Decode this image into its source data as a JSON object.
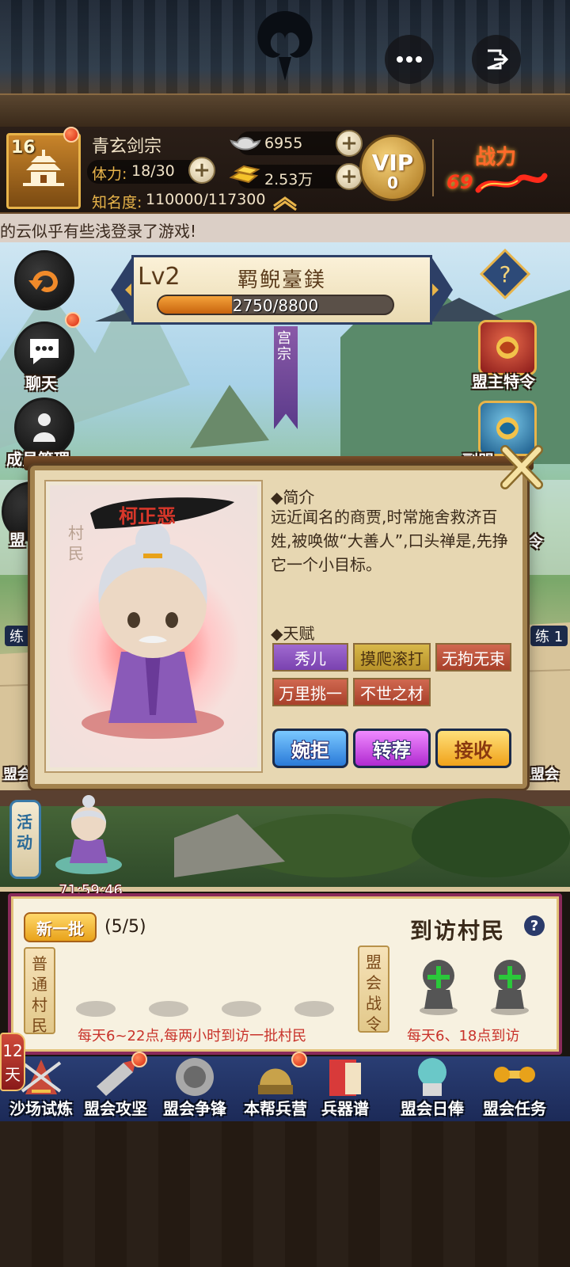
{
  "header": {
    "more_icon": "more-dots-icon",
    "exit_icon": "exit-icon"
  },
  "player": {
    "level": "16",
    "sect_name": "青玄剑宗",
    "stamina_label": "体力:",
    "stamina_value": "18/30",
    "fame_label": "知名度:",
    "fame_value": "110000/117300",
    "silver": "6955",
    "gold": "2.53万",
    "vip_label": "VIP",
    "vip_level": "0",
    "power_label": "战力",
    "power_value": "69"
  },
  "marquee": {
    "text": "的云似乎有些浅登录了游戏!"
  },
  "guild": {
    "level": "Lv2",
    "name": "羁鲵臺鎂",
    "exp_text": "2750/8800",
    "exp_current": 2750,
    "exp_max": 8800,
    "sect_ribbon": "宫宗"
  },
  "left_buttons": {
    "chat": "聊天",
    "members": "成员管理",
    "league": "盟",
    "train": "练",
    "train_num": "1",
    "meeting": "盟会"
  },
  "right_buttons": {
    "leader_order": "盟主特令",
    "second": "副盟",
    "order_short": "令",
    "train": "练",
    "train_num": "1",
    "meeting": "盟会"
  },
  "dialog": {
    "npc_name": "柯正恶",
    "npc_type": "村民",
    "intro_title": "◆简介",
    "intro_text": "远近闻名的商贾,时常施舍救济百姓,被唤做“大善人”,口头禅是,先挣它一个小目标。",
    "talent_title": "◆天赋",
    "talents": [
      "秀儿",
      "摸爬滚打",
      "无拘无束",
      "万里挑一",
      "不世之材"
    ],
    "buttons": {
      "reject": "婉拒",
      "recommend": "转荐",
      "accept": "接收"
    },
    "close_icon": "close-x-icon"
  },
  "activity": {
    "label": "活动",
    "timer": "71:59:46"
  },
  "visitor_panel": {
    "new_batch": "新一批",
    "count": "(5/5)",
    "title": "到访村民",
    "help": "?",
    "normal_label": "普通村民",
    "war_label": "盟会战令",
    "normal_note": "每天6~22点,每两小时到访一批村民",
    "war_note": "每天6、18点到访",
    "add_icon": "plus-icon"
  },
  "bottom_nav": {
    "days_badge": "12天",
    "items": [
      {
        "label": "沙场试炼",
        "icon": "battle-trial-icon"
      },
      {
        "label": "盟会攻坚",
        "icon": "siege-icon"
      },
      {
        "label": "盟会争锋",
        "icon": "contest-icon"
      },
      {
        "label": "本帮兵营",
        "icon": "barracks-icon"
      },
      {
        "label": "兵器谱",
        "icon": "weapon-book-icon"
      },
      {
        "label": "盟会日俸",
        "icon": "daily-salary-icon"
      },
      {
        "label": "盟会任务",
        "icon": "task-icon"
      }
    ]
  },
  "colors": {
    "accent_gold": "#e8b44a",
    "guild_blue": "#2d3f66",
    "exp_orange": "#f4a23a",
    "note_red": "#c8322a"
  }
}
